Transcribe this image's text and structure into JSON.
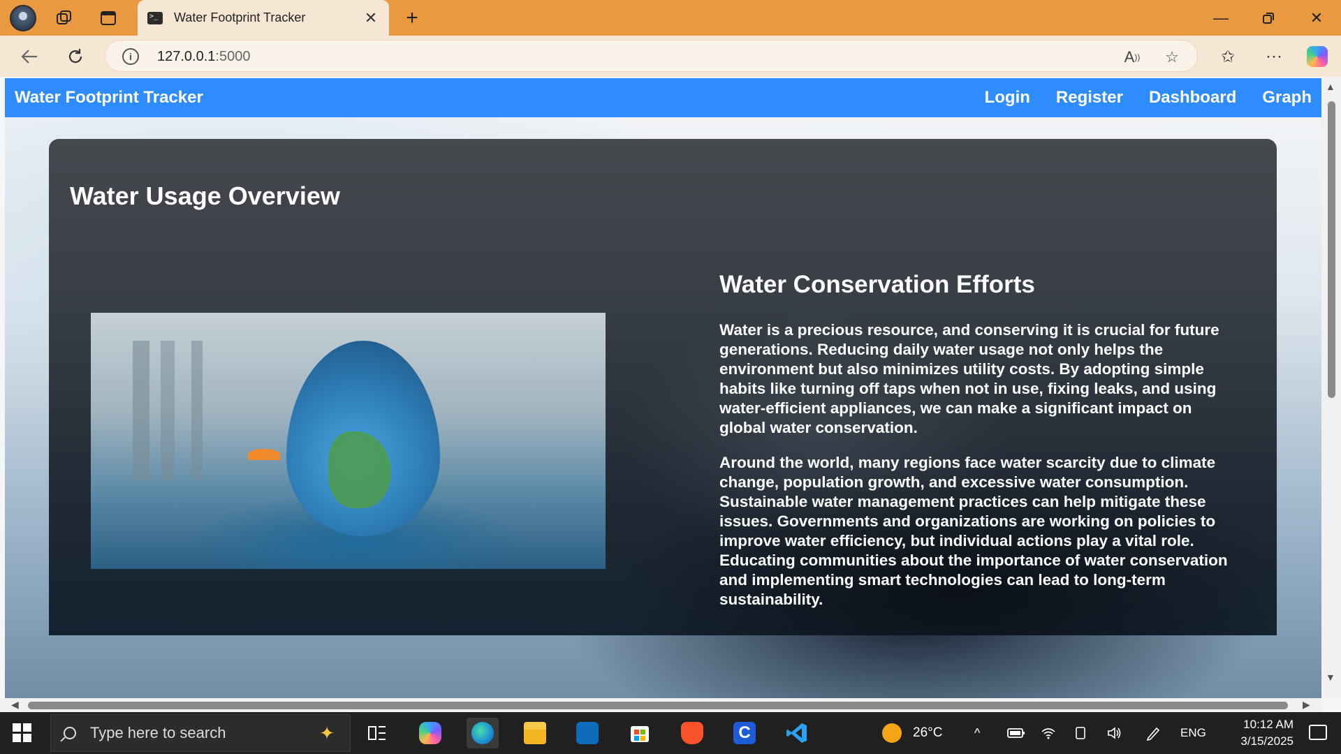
{
  "browser": {
    "tab_title": "Water Footprint Tracker",
    "url_host": "127.0.0.1",
    "url_port": ":5000"
  },
  "navbar": {
    "brand": "Water Footprint Tracker",
    "links": [
      "Login",
      "Register",
      "Dashboard",
      "Graph"
    ]
  },
  "main": {
    "card_title": "Water Usage Overview",
    "side_heading": "Water Conservation Efforts",
    "paragraph_1": "Water is a precious resource, and conserving it is crucial for future generations. Reducing daily water usage not only helps the environment but also minimizes utility costs. By adopting simple habits like turning off taps when not in use, fixing leaks, and using water-efficient appliances, we can make a significant impact on global water conservation.",
    "paragraph_2": "Around the world, many regions face water scarcity due to climate change, population growth, and excessive water consumption. Sustainable water management practices can help mitigate these issues. Governments and organizations are working on policies to improve water efficiency, but individual actions play a vital role. Educating communities about the importance of water conservation and implementing smart technologies can lead to long-term sustainability."
  },
  "taskbar": {
    "search_placeholder": "Type here to search",
    "temperature": "26°C",
    "language": "ENG",
    "time": "10:12 AM",
    "date": "3/15/2025"
  },
  "colors": {
    "chrome_accent": "#e9993f",
    "navbar": "#2e8cff"
  }
}
